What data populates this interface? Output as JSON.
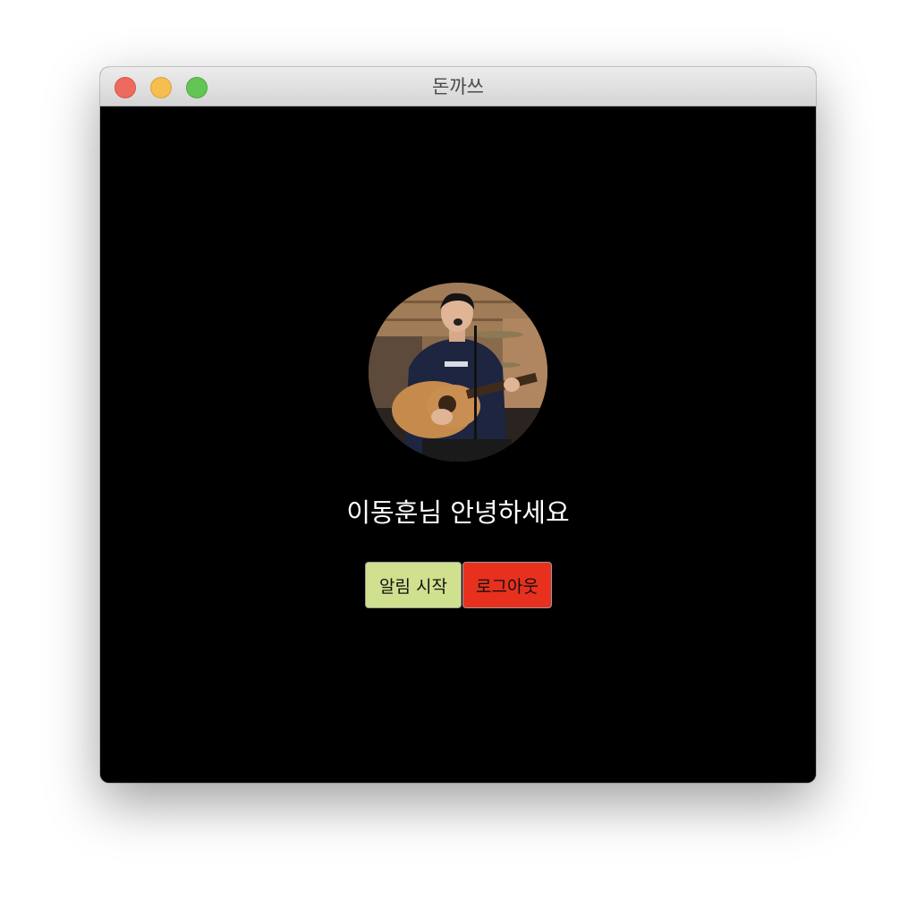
{
  "window": {
    "title": "돈까쓰"
  },
  "main": {
    "avatar_icon": "user-profile-photo",
    "greeting": "이동훈님 안녕하세요",
    "buttons": {
      "start_label": "알림 시작",
      "logout_label": "로그아웃"
    }
  },
  "colors": {
    "background": "#000000",
    "start_button": "#cfe08e",
    "logout_button": "#e8301f",
    "greeting_text": "#ffffff"
  }
}
